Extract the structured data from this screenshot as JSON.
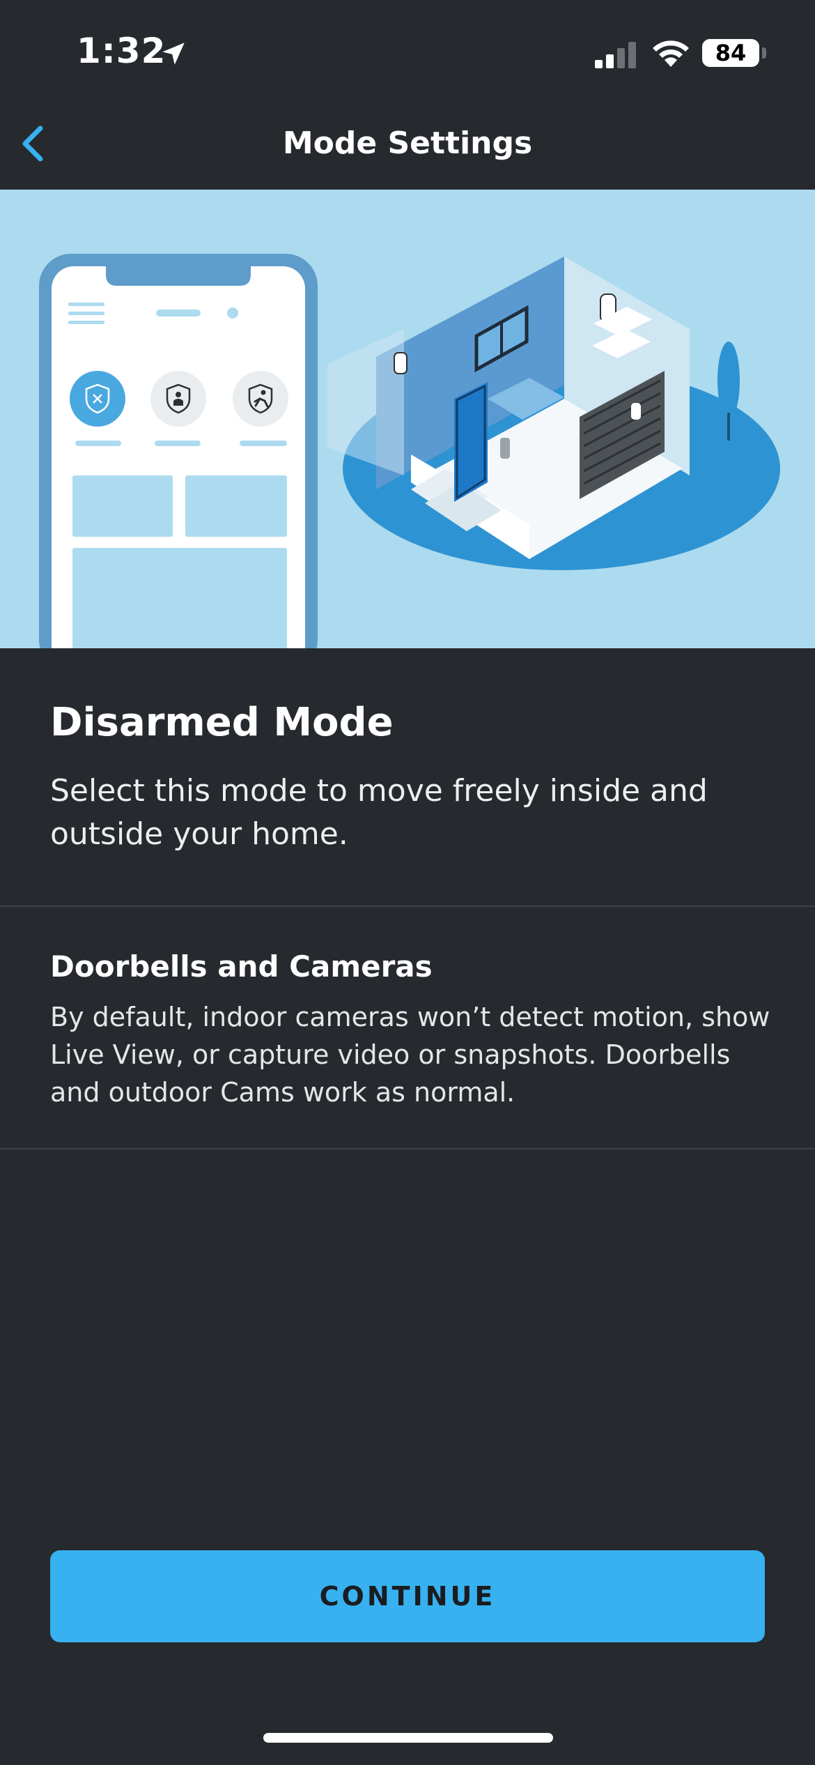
{
  "status_bar": {
    "time": "1:32",
    "battery_level": "84",
    "signal_bars_active": 2,
    "signal_bars_total": 4
  },
  "header": {
    "title": "Mode Settings",
    "back_icon": "chevron-left-icon"
  },
  "hero": {
    "mode_icons": [
      "shield-disarmed-icon",
      "home-person-icon",
      "away-running-icon"
    ],
    "selected_mode_index": 0
  },
  "mode": {
    "title": "Disarmed Mode",
    "description": "Select this mode to move freely inside and outside your home."
  },
  "devices_section": {
    "title": "Doorbells and Cameras",
    "description": "By default, indoor cameras won’t detect motion, show Live View, or capture video or snapshots. Doorbells and outdoor Cams work as normal."
  },
  "actions": {
    "continue_label": "CONTINUE"
  },
  "colors": {
    "background": "#26292d",
    "accent": "#37b1ef",
    "hero_background": "#acdbef",
    "divider": "#3d4146"
  }
}
